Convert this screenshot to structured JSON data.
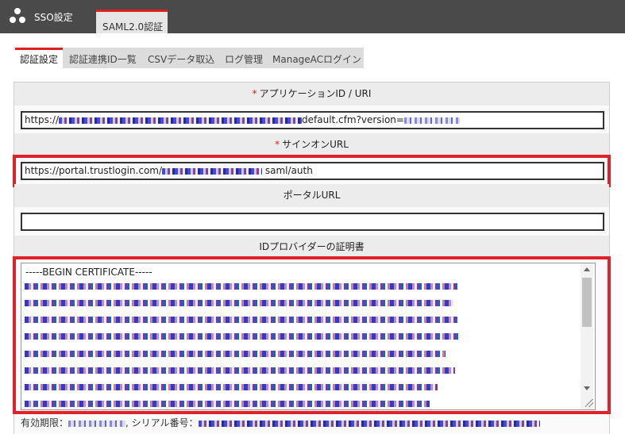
{
  "header": {
    "app_icon": "share-nodes-icon",
    "app_title": "SSO設定",
    "tab_label": "SAML2.0認証"
  },
  "subtabs": [
    {
      "label": "認証設定",
      "active": true
    },
    {
      "label": "認証連携ID一覧",
      "active": false
    },
    {
      "label": "CSVデータ取込",
      "active": false
    },
    {
      "label": "ログ管理",
      "active": false
    },
    {
      "label": "ManageACログイン",
      "active": false
    }
  ],
  "form": {
    "required_mark": "*",
    "app_id_label": "アプリケーションID / URI",
    "app_id_prefix": "https://",
    "app_id_suffix": "default.cfm?version=",
    "signon_label": "サインオンURL",
    "signon_prefix": "https://portal.trustlogin.com/",
    "signon_suffix": "saml/auth",
    "portal_label": "ポータルURL",
    "portal_value": "",
    "cert_label": "IDプロバイダーの証明書",
    "cert_begin": "-----BEGIN CERTIFICATE-----",
    "expiry_label": "有効期限：",
    "serial_label": "シリアル番号："
  },
  "colors": {
    "header_bg": "#4a4a4a",
    "accent_red": "#e02020",
    "highlight_red": "#e0222a"
  }
}
